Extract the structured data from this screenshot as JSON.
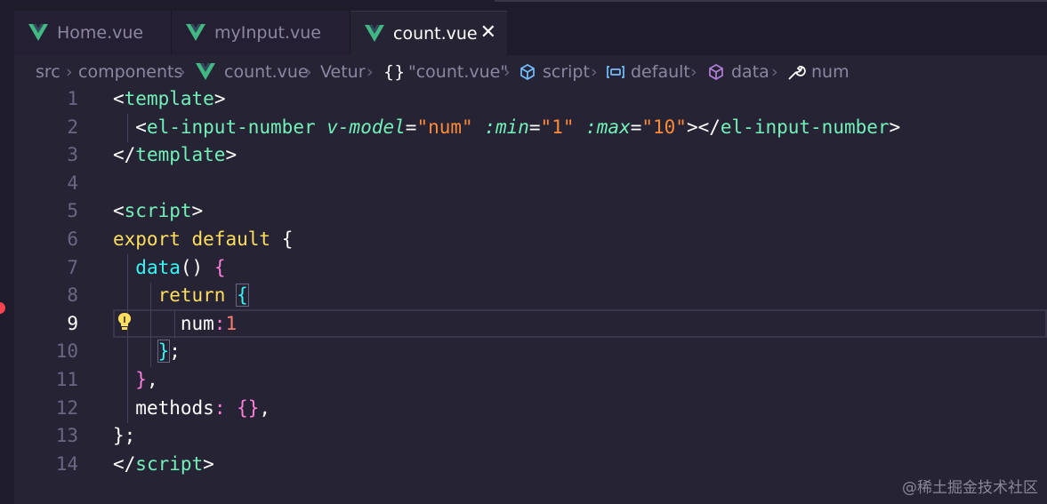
{
  "tabs": [
    {
      "label": "Home.vue",
      "active": false
    },
    {
      "label": "myInput.vue",
      "active": false
    },
    {
      "label": "count.vue",
      "active": true,
      "close_glyph": "✕"
    }
  ],
  "breadcrumb": {
    "items": [
      "src",
      "components",
      "count.vue",
      "Vetur",
      "{}",
      "\"count.vue\"",
      "script",
      "default",
      "data",
      "num"
    ],
    "separator": "›"
  },
  "editor": {
    "current_line": 9,
    "line_numbers": [
      "1",
      "2",
      "3",
      "4",
      "5",
      "6",
      "7",
      "8",
      "9",
      "10",
      "11",
      "12",
      "13",
      "14"
    ],
    "lines": {
      "l1": {
        "open": "<",
        "tag": "template",
        "close": ">"
      },
      "l2": {
        "indent": "  ",
        "open": "<",
        "tag": "el-input-number",
        "sp1": " ",
        "attr1": "v-model",
        "eq1": "=",
        "val1": "\"num\"",
        "sp2": " ",
        "attr2": ":min",
        "eq2": "=",
        "val2": "\"1\"",
        "sp3": " ",
        "attr3": ":max",
        "eq3": "=",
        "val3": "\"10\"",
        "mid": "></",
        "tag2": "el-input-number",
        "close": ">"
      },
      "l3": {
        "open": "</",
        "tag": "template",
        "close": ">"
      },
      "l5": {
        "open": "<",
        "tag": "script",
        "close": ">"
      },
      "l6": {
        "kw1": "export",
        "sp": " ",
        "kw2": "default",
        "sp2": " ",
        "brace": "{"
      },
      "l7": {
        "indent": "  ",
        "fn": "data",
        "paren": "()",
        "sp": " ",
        "brace": "{"
      },
      "l8": {
        "indent": "    ",
        "kw": "return",
        "sp": " ",
        "brace": "{"
      },
      "l9": {
        "indent": "      ",
        "prop": "num",
        "colon": ":",
        "num": "1"
      },
      "l10": {
        "indent": "    ",
        "brace": "}",
        "semi": ";"
      },
      "l11": {
        "indent": "  ",
        "brace": "}",
        "comma": ","
      },
      "l12": {
        "indent": "  ",
        "prop": "methods",
        "colon": ":",
        "sp": " ",
        "brace": "{}",
        "comma": ","
      },
      "l13": {
        "brace": "}",
        "semi": ";"
      },
      "l14": {
        "open": "</",
        "tag": "script",
        "close": ">"
      }
    }
  },
  "watermark": "@稀土掘金技术社区",
  "colors": {
    "editor_bg": "#262335",
    "tab_bar_bg": "#1e1c2b",
    "tag": "#72f1b8",
    "string": "#ff8b39",
    "keyword": "#fede5d",
    "number": "#f97e72",
    "vue_logo": "#41b883",
    "lightbulb": "#fede5d",
    "breakpoint": "#fe4450"
  }
}
